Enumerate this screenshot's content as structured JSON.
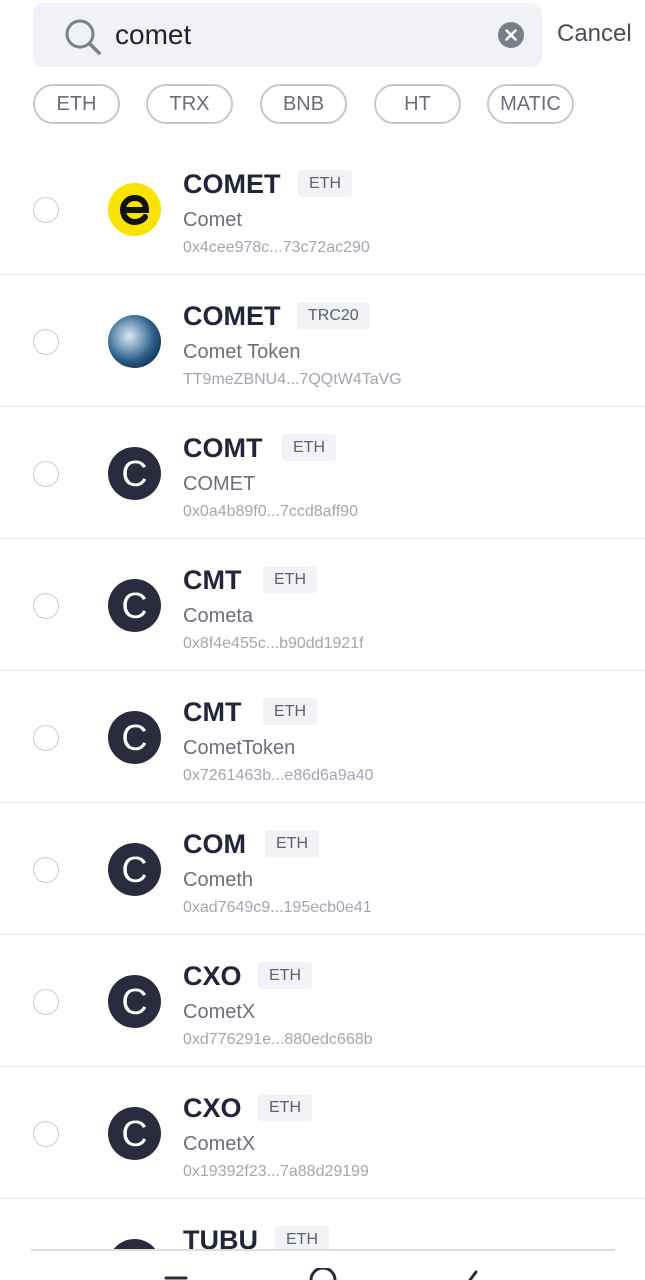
{
  "search": {
    "value": "comet",
    "cancel_label": "Cancel"
  },
  "chips": [
    "ETH",
    "TRX",
    "BNB",
    "HT",
    "MATIC"
  ],
  "tokens": [
    {
      "symbol": "COMET",
      "chain": "ETH",
      "name": "Comet",
      "address": "0x4cee978c...73c72ac290",
      "icon": "comet-e-logo-icon",
      "letter": ""
    },
    {
      "symbol": "COMET",
      "chain": "TRC20",
      "name": "Comet Token",
      "address": "TT9meZBNU4...7QQtW4TaVG",
      "icon": "globe-logo-icon",
      "letter": ""
    },
    {
      "symbol": "COMT",
      "chain": "ETH",
      "name": "COMET",
      "address": "0x0a4b89f0...7ccd8aff90",
      "icon": "letter-avatar-icon",
      "letter": "C"
    },
    {
      "symbol": "CMT",
      "chain": "ETH",
      "name": "Cometa",
      "address": "0x8f4e455c...b90dd1921f",
      "icon": "letter-avatar-icon",
      "letter": "C"
    },
    {
      "symbol": "CMT",
      "chain": "ETH",
      "name": "CometToken",
      "address": "0x7261463b...e86d6a9a40",
      "icon": "letter-avatar-icon",
      "letter": "C"
    },
    {
      "symbol": "COM",
      "chain": "ETH",
      "name": "Cometh",
      "address": "0xad7649c9...195ecb0e41",
      "icon": "letter-avatar-icon",
      "letter": "C"
    },
    {
      "symbol": "CXO",
      "chain": "ETH",
      "name": "CometX",
      "address": "0xd776291e...880edc668b",
      "icon": "letter-avatar-icon",
      "letter": "C"
    },
    {
      "symbol": "CXO",
      "chain": "ETH",
      "name": "CometX",
      "address": "0x19392f23...7a88d29199",
      "icon": "letter-avatar-icon",
      "letter": "C"
    },
    {
      "symbol": "TUBU",
      "chain": "ETH",
      "name": "",
      "address": "",
      "icon": "letter-avatar-icon",
      "letter": "C"
    }
  ],
  "colors": {
    "search_bg": "#f1f2f6",
    "avatar_dark": "#2a2c3e",
    "comet_yellow": "#f9e300",
    "chip_border": "#c6c8d0"
  }
}
